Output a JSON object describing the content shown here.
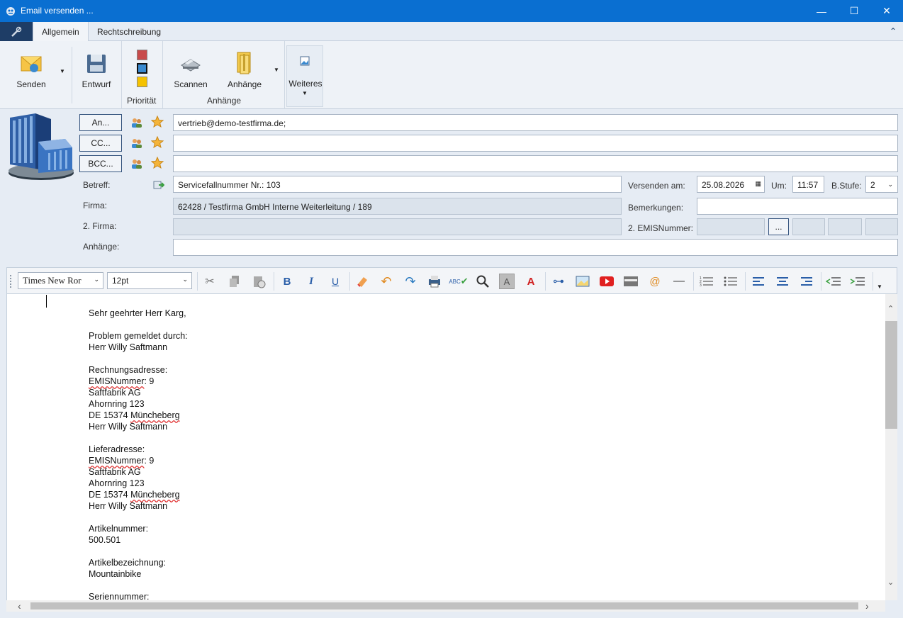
{
  "window": {
    "title": "Email versenden ...",
    "minimize": "—",
    "maximize": "☐",
    "close": "✕"
  },
  "tabs": [
    {
      "label": "Allgemein"
    },
    {
      "label": "Rechtschreibung"
    }
  ],
  "ribbon": {
    "senden": "Senden",
    "entwurf": "Entwurf",
    "prioritaet_group": "Priorität",
    "scannen": "Scannen",
    "anhaenge": "Anhänge",
    "anhaenge_group": "Anhänge",
    "weiteres": "Weiteres",
    "priority_colors": [
      "#c84b4b",
      "#3a8ad0",
      "#f5c200"
    ]
  },
  "recipients": {
    "an_button": "An...",
    "cc_button": "CC...",
    "bcc_button": "BCC...",
    "an_value": "vertrieb@demo-testfirma.de;",
    "cc_value": "",
    "bcc_value": ""
  },
  "form": {
    "betreff_label": "Betreff:",
    "betreff_value": "Servicefallnummer Nr.: 103",
    "firma_label": "Firma:",
    "firma_value": "62428 / Testfirma GmbH Interne Weiterleitung / 189",
    "firma2_label": "2. Firma:",
    "firma2_value": "",
    "anhaenge_label": "Anhänge:",
    "anhaenge_value": "",
    "versenden_label": "Versenden am:",
    "versenden_value": "25.08.2026",
    "um_label": "Um:",
    "um_value": "11:57",
    "bstufe_label": "B.Stufe:",
    "bstufe_value": "2",
    "bemerkungen_label": "Bemerkungen:",
    "bemerkungen_value": "",
    "emis2_label": "2. EMISNummer:",
    "emis2_button": "..."
  },
  "editor": {
    "font": "Times New Ror",
    "size": "12pt"
  },
  "body_lines": [
    "Sehr geehrter Herr Karg,",
    "",
    "Problem gemeldet durch:",
    "Herr Willy Saftmann",
    "",
    "Rechnungsadresse:",
    "EMISNummer: 9",
    "Saftfabrik AG",
    "Ahornring 123",
    "DE 15374 Müncheberg",
    "Herr Willy Saftmann",
    "",
    "Lieferadresse:",
    "EMISNummer: 9",
    "Saftfabrik AG",
    "Ahornring 123",
    "DE 15374 Müncheberg",
    "Herr Willy Saftmann",
    "",
    "Artikelnummer:",
    "500.501",
    "",
    "Artikelbezeichnung:",
    "Mountainbike",
    "",
    "Seriennummer:"
  ]
}
